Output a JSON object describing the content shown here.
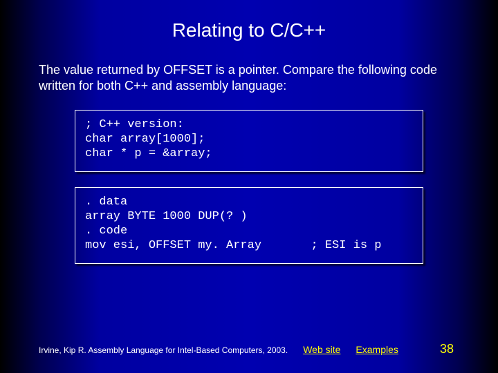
{
  "title": "Relating to C/C++",
  "body": "The value returned by OFFSET is a pointer. Compare the following code written for both C++ and assembly language:",
  "code1": "; C++ version:\nchar array[1000];\nchar * p = &array;",
  "code2": ". data\narray BYTE 1000 DUP(? )\n. code\nmov esi, OFFSET my. Array       ; ESI is p",
  "footer": {
    "credit": "Irvine, Kip R. Assembly Language for Intel-Based Computers, 2003.",
    "link1": "Web site",
    "link2": "Examples",
    "page": "38"
  }
}
